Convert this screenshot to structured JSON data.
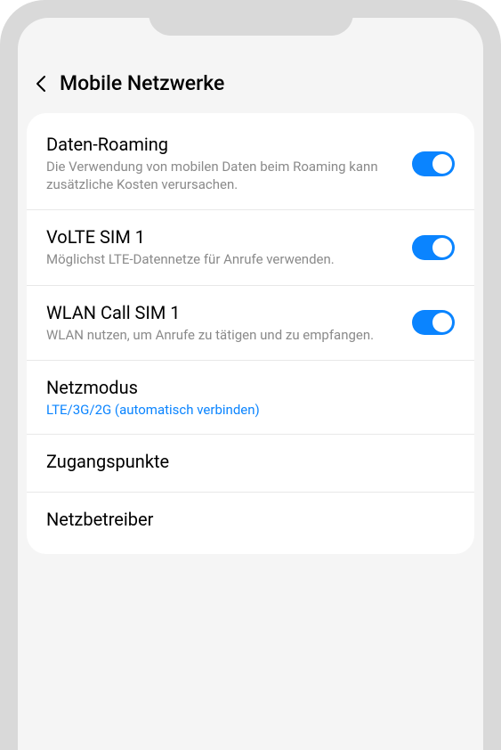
{
  "header": {
    "title": "Mobile Netzwerke"
  },
  "items": [
    {
      "title": "Daten-Roaming",
      "description": "Die Verwendung von mobilen Daten beim Roaming kann zusätzliche Kosten verursachen.",
      "toggle": true
    },
    {
      "title": "VoLTE SIM 1",
      "description": "Möglichst LTE-Datennetze für Anrufe verwenden.",
      "toggle": true
    },
    {
      "title": "WLAN Call SIM 1",
      "description": "WLAN nutzen, um Anrufe zu tätigen und zu empfangen.",
      "toggle": true
    },
    {
      "title": "Netzmodus",
      "value": "LTE/3G/2G (automatisch verbinden)"
    },
    {
      "title": "Zugangspunkte"
    },
    {
      "title": "Netzbetreiber"
    }
  ]
}
